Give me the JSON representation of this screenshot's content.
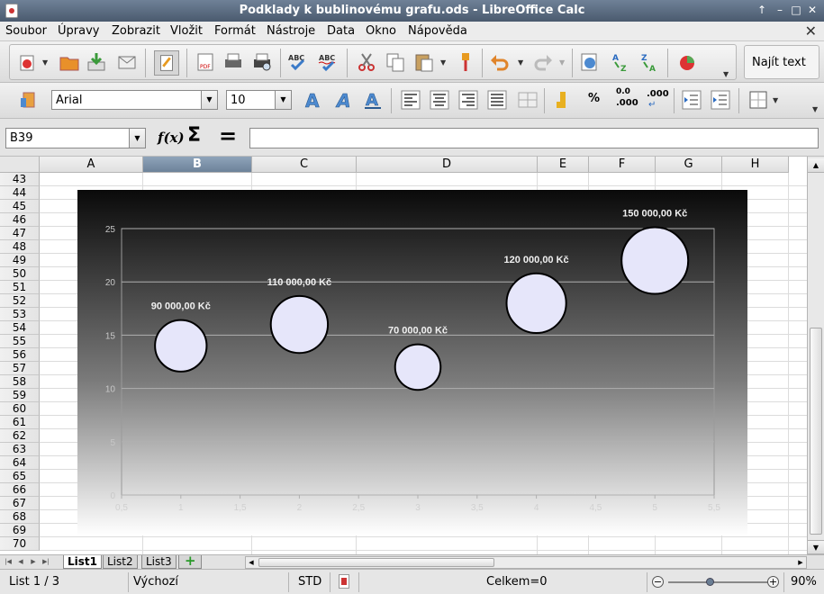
{
  "window": {
    "title": "Podklady k bublinovému grafu.ods - LibreOffice Calc"
  },
  "menu": [
    "Soubor",
    "Úpravy",
    "Zobrazit",
    "Vložit",
    "Formát",
    "Nástroje",
    "Data",
    "Okno",
    "Nápověda"
  ],
  "toolbar": {
    "find_label": "Najít text"
  },
  "format": {
    "font_name": "Arial",
    "font_size": "10",
    "percent": "%",
    "thousands": ".000",
    "thousands_add": ".000",
    "thousands_del": ".000"
  },
  "formula_bar": {
    "cell_ref": "B39",
    "formula": ""
  },
  "columns": [
    "A",
    "B",
    "C",
    "D",
    "E",
    "F",
    "G",
    "H"
  ],
  "selected_column": "B",
  "rows": [
    "43",
    "44",
    "45",
    "46",
    "47",
    "48",
    "49",
    "50",
    "51",
    "52",
    "53",
    "54",
    "55",
    "56",
    "57",
    "58",
    "59",
    "60",
    "61",
    "62",
    "63",
    "64",
    "65",
    "66",
    "67",
    "68",
    "69",
    "70"
  ],
  "chart_data": {
    "type": "bubble",
    "x_ticks": [
      "0,5",
      "1",
      "1,5",
      "2",
      "2,5",
      "3",
      "3,5",
      "4",
      "4,5",
      "5",
      "5,5"
    ],
    "y_ticks": [
      "0",
      "5",
      "10",
      "15",
      "20",
      "25"
    ],
    "xlim": [
      0.5,
      5.5
    ],
    "ylim": [
      0,
      25
    ],
    "grid": "horizontal",
    "bubble_color": "#e6e6fa",
    "background": "dark gradient",
    "points": [
      {
        "x": 1,
        "y": 14,
        "size": 90000,
        "label": "90 000,00 Kč"
      },
      {
        "x": 2,
        "y": 16,
        "size": 110000,
        "label": "110 000,00 Kč"
      },
      {
        "x": 3,
        "y": 12,
        "size": 70000,
        "label": "70 000,00 Kč"
      },
      {
        "x": 4,
        "y": 18,
        "size": 120000,
        "label": "120 000,00 Kč"
      },
      {
        "x": 5,
        "y": 22,
        "size": 150000,
        "label": "150 000,00 Kč"
      }
    ]
  },
  "sheets": [
    "List1",
    "List2",
    "List3"
  ],
  "active_sheet": "List1",
  "status": {
    "sheet_info": "List 1 / 3",
    "page_style": "Výchozí",
    "mode": "STD",
    "sum": "Celkem=0",
    "zoom": "90%"
  }
}
